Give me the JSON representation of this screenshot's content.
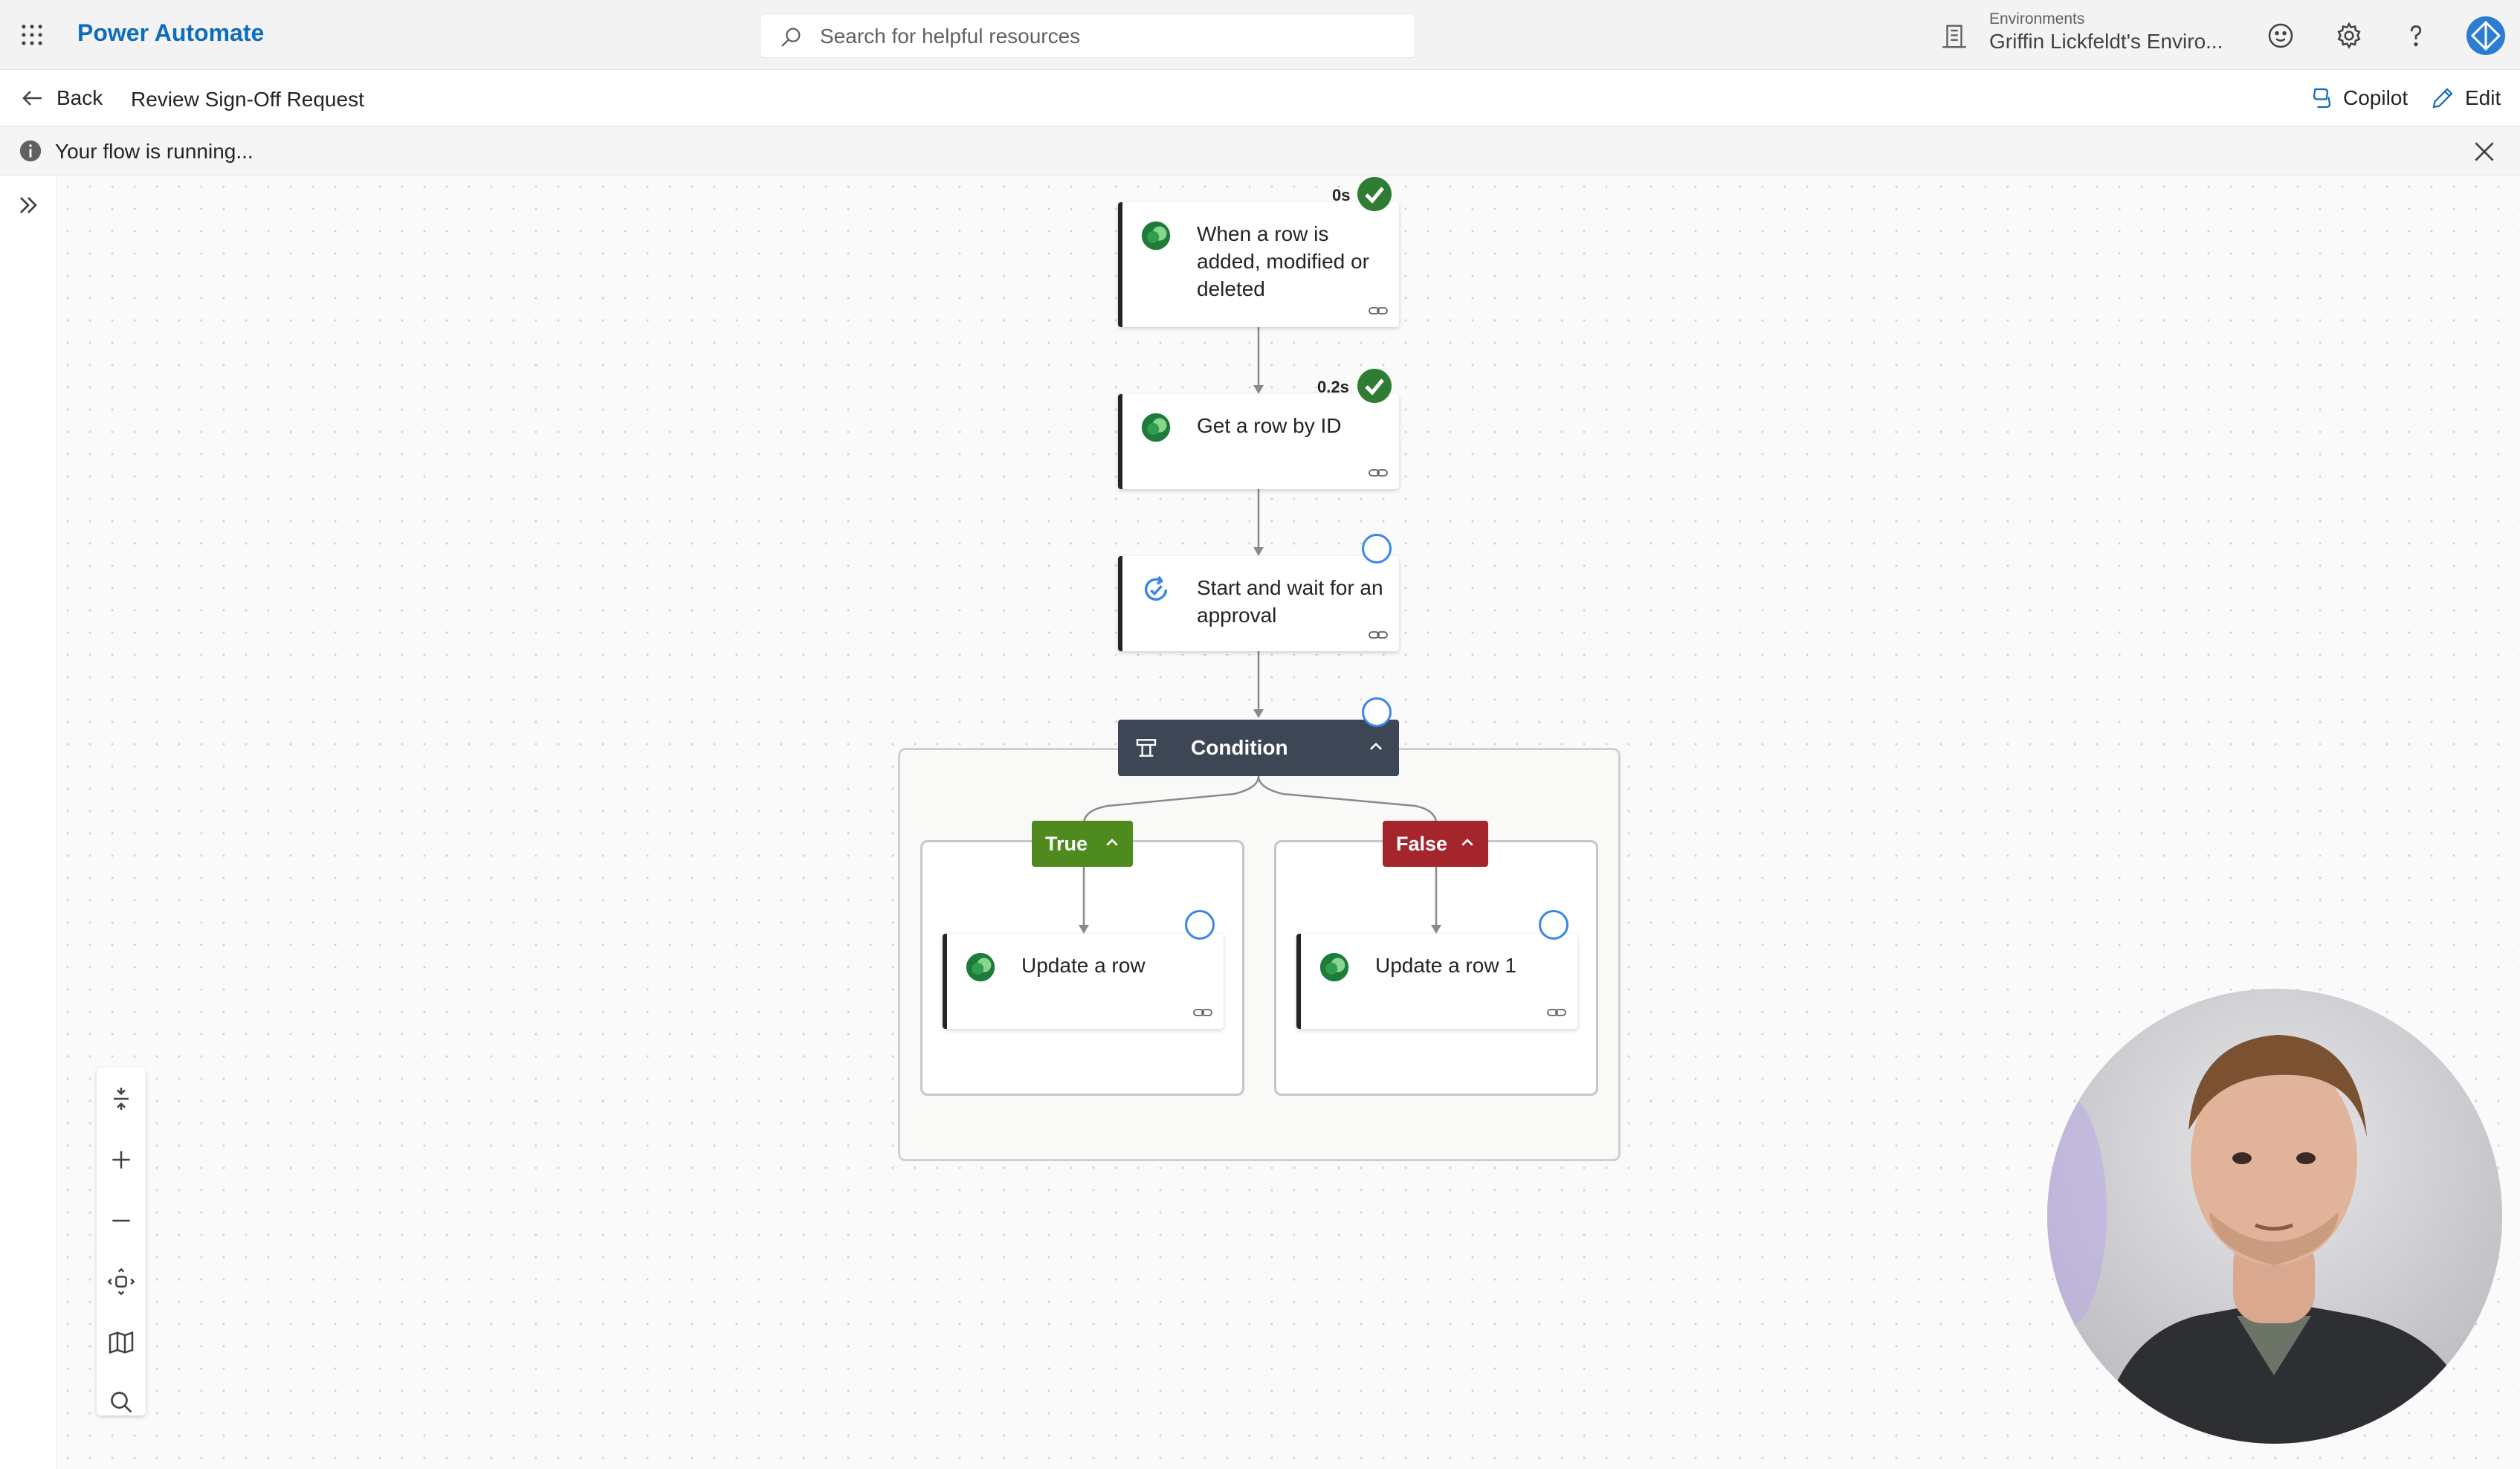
{
  "header": {
    "app_name": "Power Automate",
    "search_placeholder": "Search for helpful resources",
    "environment_label": "Environments",
    "environment_name": "Griffin Lickfeldt's Enviro..."
  },
  "commandbar": {
    "back_label": "Back",
    "flow_title": "Review Sign-Off Request",
    "copilot_label": "Copilot",
    "edit_label": "Edit"
  },
  "infobar": {
    "message": "Your flow is running..."
  },
  "flow": {
    "trigger": {
      "title": "When a row is added, modified or deleted",
      "duration": "0s",
      "status": "succeeded"
    },
    "step2": {
      "title": "Get a row by ID",
      "duration": "0.2s",
      "status": "succeeded"
    },
    "step3": {
      "title": "Start and wait for an approval",
      "status": "running"
    },
    "condition": {
      "title": "Condition",
      "status": "running"
    },
    "true_branch": {
      "label": "True",
      "action_title": "Update a row",
      "status": "running"
    },
    "false_branch": {
      "label": "False",
      "action_title": "Update a row 1",
      "status": "running"
    }
  },
  "colors": {
    "brand": "#0f6cbd",
    "success": "#2e7d32",
    "true_branch": "#4f8a1f",
    "false_branch": "#a4262c",
    "condition_header": "#3d4654",
    "running": "#3a86e8"
  },
  "icons": {
    "waffle": "waffle-icon",
    "search": "search-icon",
    "environment": "environment-icon",
    "feedback": "smiley-icon",
    "settings": "gear-icon",
    "help": "question-icon",
    "dataverse": "dataverse-icon",
    "approval": "approval-icon",
    "condition": "condition-icon"
  }
}
